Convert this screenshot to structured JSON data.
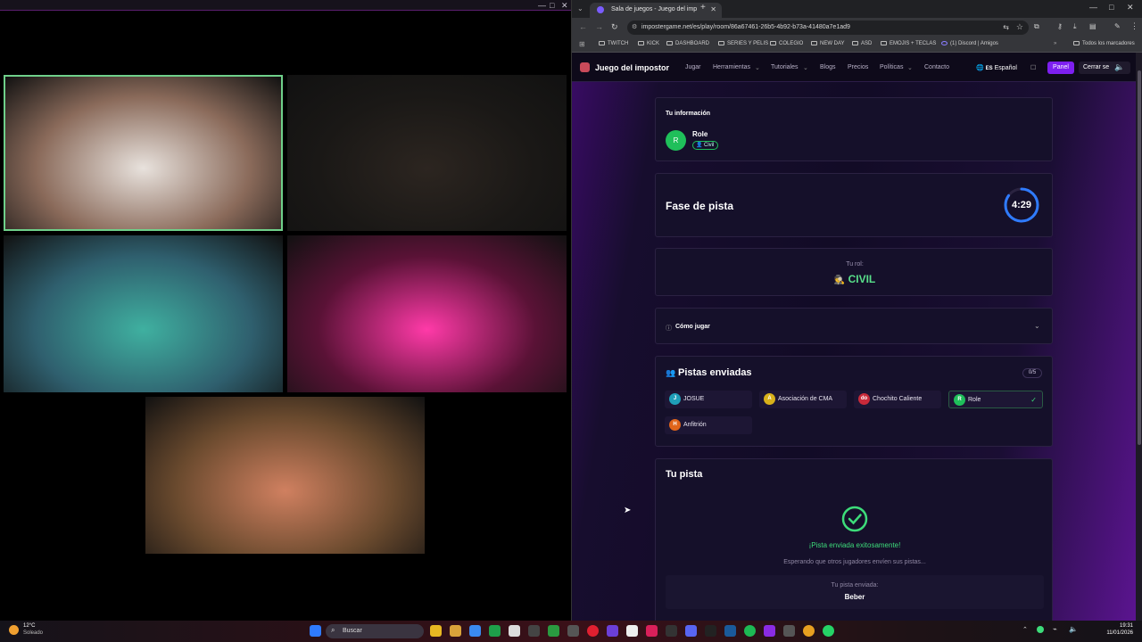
{
  "obs": {
    "controls": [
      "—",
      "□",
      "✕"
    ]
  },
  "cams": [
    {
      "name": "webcam-top-left",
      "bg": "#8a6a5a",
      "accent": "#e8e2dd",
      "label": ""
    },
    {
      "name": "webcam-top-right",
      "bg": "#1a1816",
      "accent": "#2c2520",
      "label": ""
    },
    {
      "name": "webcam-mid-left",
      "bg": "#2f5f6e",
      "accent": "#3fb0a0",
      "label": ""
    },
    {
      "name": "webcam-mid-right",
      "bg": "#5a1236",
      "accent": "#ff3aa8",
      "label": ""
    },
    {
      "name": "webcam-bottom",
      "bg": "#6a4a2e",
      "accent": "#d08060",
      "label": ""
    }
  ],
  "browser": {
    "tab_title": "Sala de juegos - Juego del imp",
    "url": "impostergame.net/es/play/room/86a67461-26b5-4b92-b73a-41480a7e1ad9",
    "bookmarks": [
      "TWITCH",
      "KICK",
      "DASHBOARD",
      "SERIES Y PELIS",
      "COLEGIO",
      "NEW DAY",
      "ASD",
      "EMOJIS + TECLAS",
      "(1) Discord | Amigos",
      "Todos los marcadores"
    ],
    "window_controls": [
      "—",
      "□",
      "✕"
    ]
  },
  "site": {
    "brand": "Juego del impostor",
    "nav": [
      "Jugar",
      "Herramientas",
      "Tutoriales",
      "Blogs",
      "Precios",
      "Políticas",
      "Contacto"
    ],
    "language": "Español",
    "panel_btn": "Panel",
    "logout_btn": "Cerrar se",
    "info": {
      "title": "Tu información",
      "avatar": "R",
      "name": "Role",
      "badge": "Civil"
    },
    "phase": {
      "title": "Fase de pista",
      "timer": "4:29",
      "progress": 0.85
    },
    "role": {
      "label": "Tu rol:",
      "value": "CIVIL"
    },
    "howto": "Cómo jugar",
    "clues": {
      "title": "Pistas enviadas",
      "count": "0/5",
      "players": [
        {
          "initial": "J",
          "name": "JOSUE",
          "color": "#1f9fb8",
          "done": false
        },
        {
          "initial": "A",
          "name": "Asociación de CMA",
          "color": "#d8b11a",
          "done": false
        },
        {
          "initial": "do",
          "name": "Chochito Caliente",
          "color": "#c92a3a",
          "done": false
        },
        {
          "initial": "R",
          "name": "Role",
          "color": "#1fbf5a",
          "done": true
        },
        {
          "initial": "H",
          "name": "Anfitrión",
          "color": "#e0651a",
          "done": false
        }
      ]
    },
    "my_clue": {
      "title": "Tu pista",
      "success": "¡Pista enviada exitosamente!",
      "waiting": "Esperando que otros jugadores envíen sus pistas...",
      "sent_label": "Tu pista enviada:",
      "sent_value": "Beber"
    }
  },
  "taskbar": {
    "weather_temp": "12°C",
    "weather_desc": "Soleado",
    "search": "Buscar",
    "time": "19:31",
    "date": "11/01/2026"
  }
}
